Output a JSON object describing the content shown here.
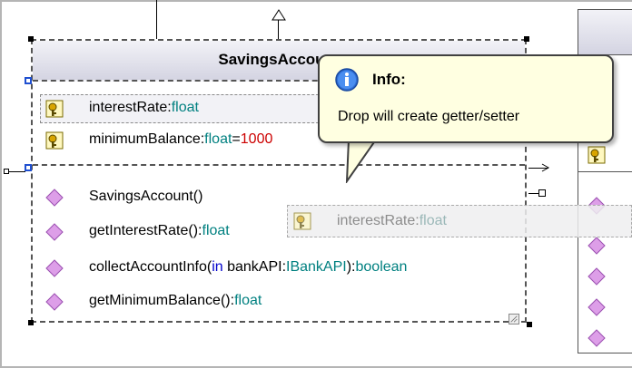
{
  "class": {
    "name": "SavingsAccount",
    "attributes": [
      {
        "name": "interestRate",
        "sep": ":",
        "type": "float"
      },
      {
        "name": "minimumBalance",
        "sep": ":",
        "type": "float",
        "eq": "=",
        "default": "1000"
      }
    ],
    "operations": [
      {
        "name": "SavingsAccount()"
      },
      {
        "name": "getInterestRate():",
        "type": "float"
      },
      {
        "name": "collectAccountInfo(",
        "kw": "in",
        "param": " bankAPI:",
        "ptype": "IBankAPI",
        "close": "):",
        "type": "boolean"
      },
      {
        "name": "getMinimumBalance():",
        "type": "float"
      }
    ]
  },
  "drag_item": {
    "name": "interestRate:",
    "type": "float"
  },
  "tooltip": {
    "title": "Info:",
    "message": "Drop will create getter/setter"
  },
  "icons": {
    "attribute": "key-attribute-icon",
    "operation": "diamond-operation-icon",
    "info": "info-icon"
  },
  "colors": {
    "type": "#008080",
    "default_value": "#cc0000",
    "keyword": "#0000cc",
    "operation": "#d68ee0",
    "tooltip_bg": "#ffffe1",
    "header": "#d4d4e2"
  }
}
